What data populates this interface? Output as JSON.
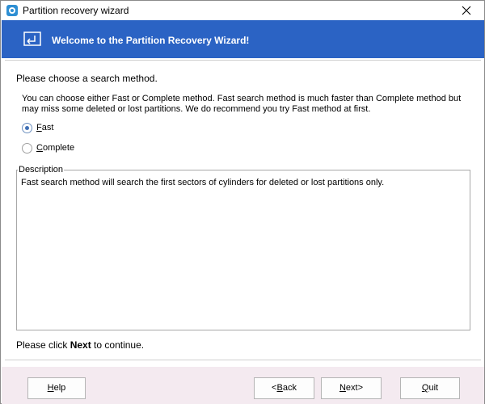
{
  "window": {
    "title": "Partition recovery wizard"
  },
  "banner": {
    "title": "Welcome to the Partition Recovery Wizard!"
  },
  "content": {
    "prompt": "Please choose a search method.",
    "info": "You can choose either Fast or Complete method. Fast search method is much faster than Complete method but may miss some deleted or lost partitions. We do recommend you try Fast method at first.",
    "options": [
      {
        "mnemonic": "F",
        "rest": "ast",
        "checked": true
      },
      {
        "mnemonic": "C",
        "rest": "omplete",
        "checked": false
      }
    ],
    "description_label": "Description",
    "description_text": "Fast search method will search the first sectors of cylinders for deleted or lost partitions only.",
    "continue_prefix": "Please click ",
    "continue_bold": "Next",
    "continue_suffix": " to continue."
  },
  "footer": {
    "help": {
      "mnemonic": "H",
      "rest": "elp"
    },
    "back": {
      "prefix": "<",
      "mnemonic": "B",
      "rest": "ack"
    },
    "next": {
      "mnemonic": "N",
      "rest": "ext>"
    },
    "quit": {
      "mnemonic": "Q",
      "rest": "uit"
    }
  },
  "colors": {
    "banner": "#2b63c4",
    "footer": "#f4eaf0"
  },
  "icons": {
    "app": "app-icon",
    "banner": "restore-monitor-icon",
    "close": "close-icon"
  }
}
